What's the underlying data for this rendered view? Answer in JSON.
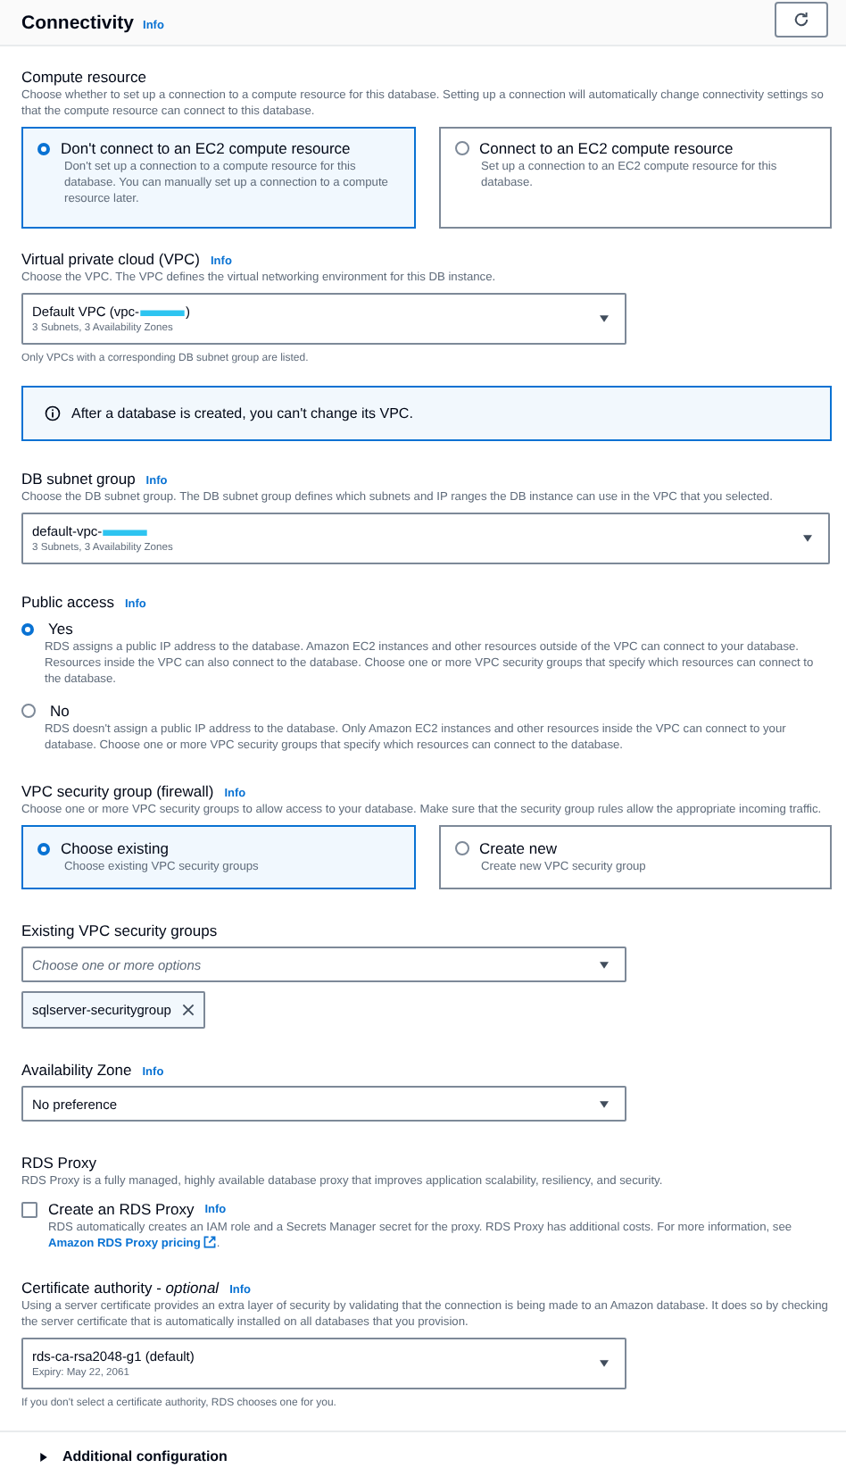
{
  "header": {
    "title": "Connectivity",
    "info": "Info"
  },
  "sections": [
    {
      "kind": "tiles",
      "label": "Compute resource",
      "description": "Choose whether to set up a connection to a compute resource for this database. Setting up a connection will automatically change connectivity settings so that the compute resource can connect to this database.",
      "options": [
        {
          "title": "Don't connect to an EC2 compute resource",
          "description": "Don't set up a connection to a compute resource for this database. You can manually set up a connection to a compute resource later.",
          "selected": true
        },
        {
          "title": "Connect to an EC2 compute resource",
          "description": "Set up a connection to an EC2 compute resource for this database.",
          "selected": false
        }
      ]
    },
    {
      "kind": "select",
      "label": "Virtual private cloud (VPC)",
      "info": "Info",
      "description": "Choose the VPC. The VPC defines the virtual networking environment for this DB instance.",
      "value": "Default VPC (vpc-",
      "value_end": ")",
      "redacted": true,
      "secondary": "3 Subnets, 3 Availability Zones",
      "note": "Only VPCs with a corresponding DB subnet group are listed.",
      "full_width": false
    },
    {
      "kind": "alert",
      "text": "After a database is created, you can't change its VPC."
    },
    {
      "kind": "select",
      "label": "DB subnet group",
      "info": "Info",
      "description": "Choose the DB subnet group. The DB subnet group defines which subnets and IP ranges the DB instance can use in the VPC that you selected.",
      "value": "default-vpc-",
      "redacted": true,
      "secondary": "3 Subnets, 3 Availability Zones",
      "full_width": true
    },
    {
      "kind": "radios",
      "label": "Public access",
      "info": "Info",
      "options": [
        {
          "title": "Yes",
          "description": "RDS assigns a public IP address to the database. Amazon EC2 instances and other resources outside of the VPC can connect to your database. Resources inside the VPC can also connect to the database. Choose one or more VPC security groups that specify which resources can connect to the database.",
          "selected": true
        },
        {
          "title": "No",
          "description": "RDS doesn't assign a public IP address to the database. Only Amazon EC2 instances and other resources inside the VPC can connect to your database. Choose one or more VPC security groups that specify which resources can connect to the database.",
          "selected": false
        }
      ]
    },
    {
      "kind": "tiles",
      "label": "VPC security group (firewall)",
      "info": "Info",
      "description": "Choose one or more VPC security groups to allow access to your database. Make sure that the security group rules allow the appropriate incoming traffic.",
      "options": [
        {
          "title": "Choose existing",
          "description": "Choose existing VPC security groups",
          "selected": true
        },
        {
          "title": "Create new",
          "description": "Create new VPC security group",
          "selected": false
        }
      ]
    },
    {
      "kind": "multiselect",
      "label": "Existing VPC security groups",
      "placeholder": "Choose one or more options",
      "tokens": [
        "sqlserver-securitygroup"
      ]
    },
    {
      "kind": "select",
      "label": "Availability Zone",
      "info": "Info",
      "value": "No preference",
      "full_width": false
    },
    {
      "kind": "checkbox",
      "label": "RDS Proxy",
      "description": "RDS Proxy is a fully managed, highly available database proxy that improves application scalability, resiliency, and security.",
      "option": {
        "title": "Create an RDS Proxy",
        "info": "Info",
        "checked": false,
        "description": "RDS automatically creates an IAM role and a Secrets Manager secret for the proxy. RDS Proxy has additional costs. For more information, see ",
        "link": "Amazon RDS Proxy pricing",
        "description_end": "."
      }
    },
    {
      "kind": "select",
      "label": "Certificate authority - *optional*",
      "info": "Info",
      "description": "Using a server certificate provides an extra layer of security by validating that the connection is being made to an Amazon database. It does so by checking the server certificate that is automatically installed on all databases that you provision.",
      "value": "rds-ca-rsa2048-g1 (default)",
      "secondary": "Expiry: May 22, 2061",
      "note": "If you don't select a certificate authority, RDS chooses one for you.",
      "full_width": false
    }
  ],
  "footer": {
    "label": "Additional configuration",
    "expanded": false
  }
}
